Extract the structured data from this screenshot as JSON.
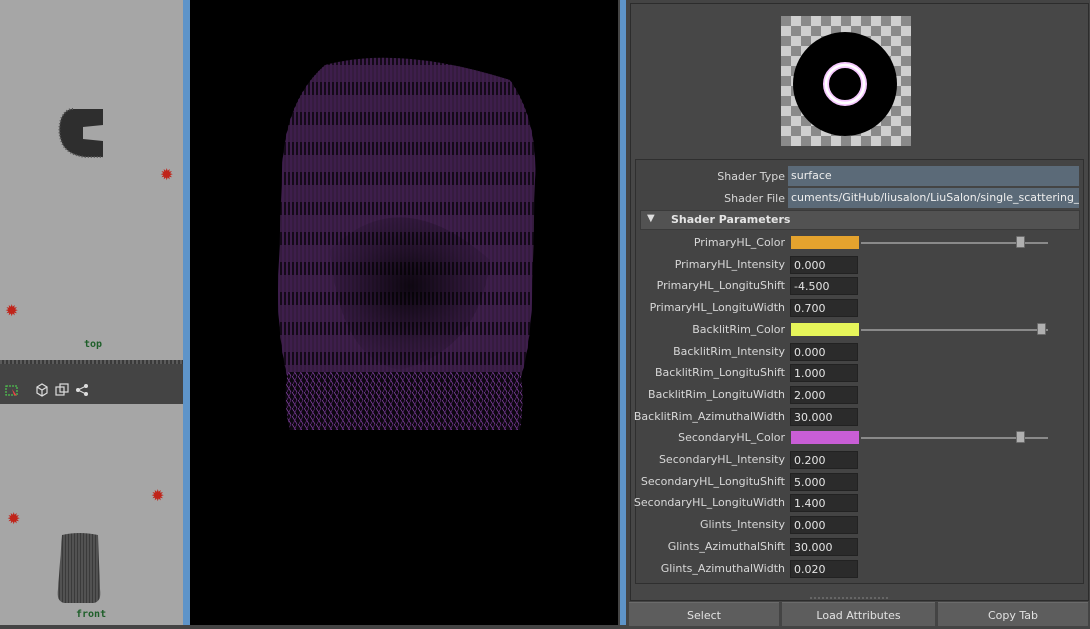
{
  "left_viewports": {
    "top_label": "top",
    "front_label": "front"
  },
  "shader": {
    "type_label": "Shader Type",
    "type_value": "surface",
    "file_label": "Shader File",
    "file_value": "cuments/GitHub/liusalon/LiuSalon/single_scattering_AFC.sdl"
  },
  "section_title": "Shader Parameters",
  "params": [
    {
      "label": "PrimaryHL_Color",
      "kind": "color",
      "color": "#e5a32e",
      "slider": 0.85
    },
    {
      "label": "PrimaryHL_Intensity",
      "kind": "num",
      "value": "0.000"
    },
    {
      "label": "PrimaryHL_LongituShift",
      "kind": "num",
      "value": "-4.500"
    },
    {
      "label": "PrimaryHL_LongituWidth",
      "kind": "num",
      "value": "0.700"
    },
    {
      "label": "BacklitRim_Color",
      "kind": "color",
      "color": "#e6f55a",
      "slider": 0.96
    },
    {
      "label": "BacklitRim_Intensity",
      "kind": "num",
      "value": "0.000"
    },
    {
      "label": "BacklitRim_LongituShift",
      "kind": "num",
      "value": "1.000"
    },
    {
      "label": "BacklitRim_LongituWidth",
      "kind": "num",
      "value": "2.000"
    },
    {
      "label": "BacklitRim_AzimuthalWidth",
      "kind": "num",
      "value": "30.000"
    },
    {
      "label": "SecondaryHL_Color",
      "kind": "color",
      "color": "#c95ed6",
      "slider": 0.85
    },
    {
      "label": "SecondaryHL_Intensity",
      "kind": "num",
      "value": "0.200"
    },
    {
      "label": "SecondaryHL_LongituShift",
      "kind": "num",
      "value": "5.000"
    },
    {
      "label": "SecondaryHL_LongituWidth",
      "kind": "num",
      "value": "1.400"
    },
    {
      "label": "Glints_Intensity",
      "kind": "num",
      "value": "0.000"
    },
    {
      "label": "Glints_AzimuthalShift",
      "kind": "num",
      "value": "30.000"
    },
    {
      "label": "Glints_AzimuthalWidth",
      "kind": "num",
      "value": "0.020"
    }
  ],
  "buttons": {
    "select": "Select",
    "load": "Load Attributes",
    "copy": "Copy Tab"
  },
  "colors": {
    "accent_divider": "#5e94c9",
    "render_bg": "#000000",
    "hair": "#8a3fa8"
  },
  "icons": [
    "select-camera-icon",
    "cube-icon",
    "copy-layers-icon",
    "share-nodes-icon",
    "light-star-icon",
    "collapse-triangle-icon"
  ]
}
